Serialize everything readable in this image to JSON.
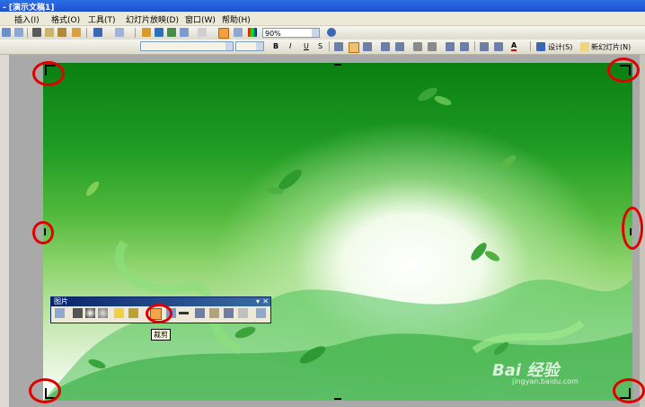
{
  "window": {
    "title": "- [演示文稿1]"
  },
  "menu": [
    {
      "label": "插入(I)"
    },
    {
      "label": "格式(O)"
    },
    {
      "label": "工具(T)"
    },
    {
      "label": "幻灯片放映(D)"
    },
    {
      "label": "窗口(W)"
    },
    {
      "label": "帮助(H)"
    }
  ],
  "toolbar": {
    "zoom": "90%",
    "font_name": "",
    "font_size": "",
    "design_label": "设计(S)",
    "new_slide_label": "新幻灯片(N)",
    "bold": "B",
    "italic": "I",
    "underline": "U",
    "shadow": "S",
    "font_color": "A"
  },
  "picture_toolbar": {
    "title": "图片",
    "tooltip": "裁剪"
  },
  "watermark": {
    "text": "Bai 经验",
    "sub": "jingyan.baidu.com"
  },
  "colors": {
    "highlight": "#e00000",
    "accent_green": "#0a7f12"
  }
}
